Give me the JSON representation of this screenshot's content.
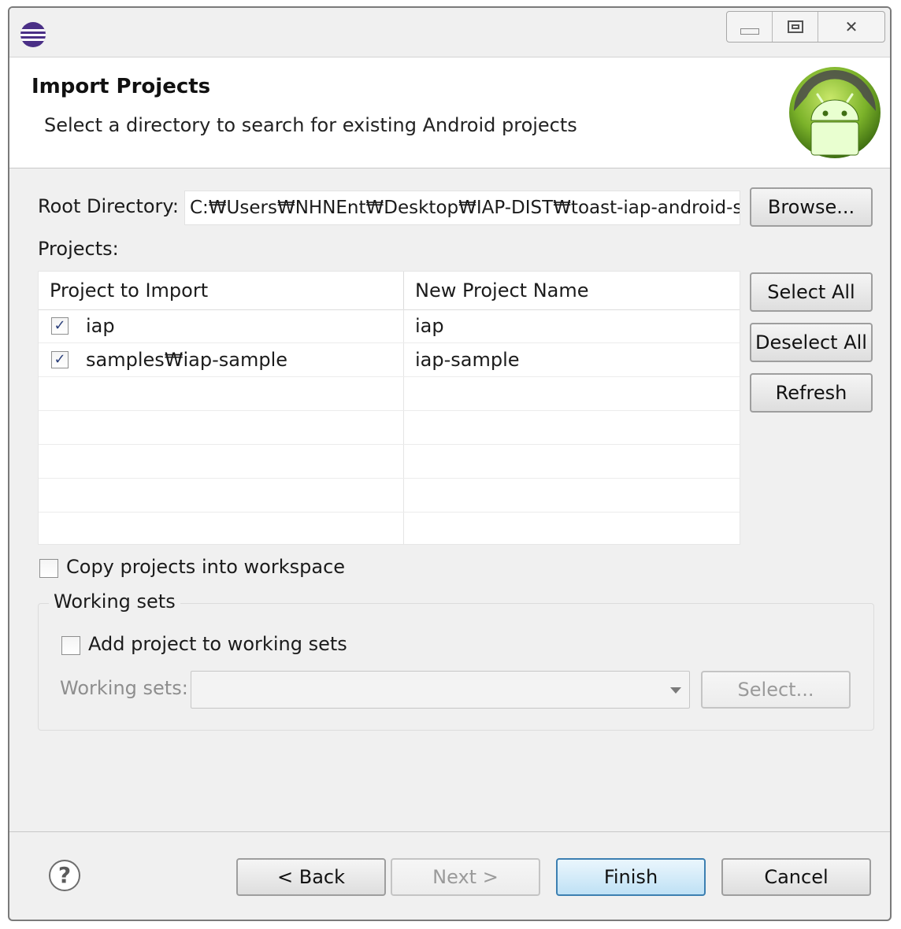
{
  "window": {
    "title_icon": "eclipse-icon",
    "controls": {
      "minimize": "minimize-icon",
      "restore": "restore-icon",
      "close_glyph": "✕"
    }
  },
  "header": {
    "title": "Import Projects",
    "description": "Select a directory to search for existing Android projects",
    "banner_icon": "android-icon"
  },
  "root_directory": {
    "label": "Root Directory:",
    "value": "C:₩Users₩NHNEnt₩Desktop₩IAP-DIST₩toast-iap-android-s",
    "browse_label": "Browse..."
  },
  "projects": {
    "label": "Projects:",
    "columns": [
      "Project to Import",
      "New Project Name"
    ],
    "rows": [
      {
        "project": "iap",
        "new_name": "iap",
        "checked": true
      },
      {
        "project": "samples₩iap-sample",
        "new_name": "iap-sample",
        "checked": true
      }
    ],
    "check_glyph": "✓",
    "buttons": {
      "select_all": "Select All",
      "deselect_all": "Deselect All",
      "refresh": "Refresh"
    }
  },
  "copy_projects": {
    "label": "Copy projects into workspace",
    "checked": false
  },
  "working_sets": {
    "group_title": "Working sets",
    "add_label": "Add project to working sets",
    "add_checked": false,
    "sets_label": "Working sets:",
    "select_label": "Select..."
  },
  "footer": {
    "help_glyph": "?",
    "back_label": "< Back",
    "next_label": "Next >",
    "finish_label": "Finish",
    "cancel_label": "Cancel"
  }
}
